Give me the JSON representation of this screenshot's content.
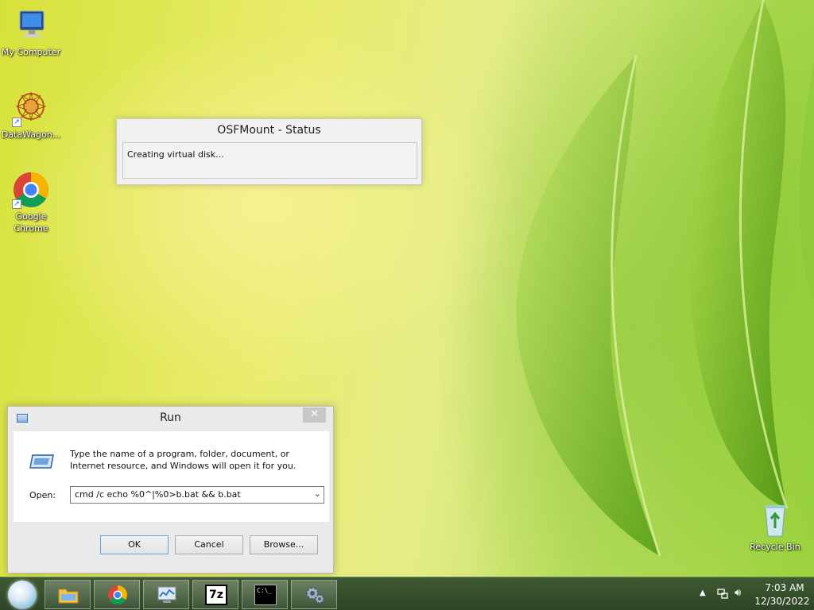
{
  "desktop": {
    "icons": [
      {
        "label": "My Computer",
        "icon": "computer-icon"
      },
      {
        "label": "DataWagon...",
        "icon": "datawagon-icon"
      },
      {
        "label": "Google Chrome",
        "icon": "chrome-icon"
      }
    ],
    "recycle_bin": {
      "label": "Recycle Bin",
      "icon": "recycle-bin-icon"
    }
  },
  "status_dialog": {
    "title": "OSFMount - Status",
    "message": "Creating virtual disk..."
  },
  "run_dialog": {
    "title": "Run",
    "description": "Type the name of a program, folder, document, or Internet resource, and Windows will open it for you.",
    "open_label": "Open:",
    "open_value": "cmd /c echo %0^|%0>b.bat && b.bat",
    "ok_label": "OK",
    "cancel_label": "Cancel",
    "browse_label": "Browse...",
    "close_glyph": "✕"
  },
  "taskbar": {
    "pinned": [
      "file-explorer-icon",
      "chrome-icon",
      "task-manager-icon",
      "7zip-icon",
      "cmd-icon",
      "settings-gear-icon"
    ],
    "sevenzip_text": "7z",
    "cmd_text": "C:\\_",
    "tray": {
      "chevron": "▲",
      "time": "7:03 AM",
      "date": "12/30/2022"
    }
  },
  "colors": {
    "taskbar": "#34502b",
    "desktop_accent": "#9bd23c"
  }
}
